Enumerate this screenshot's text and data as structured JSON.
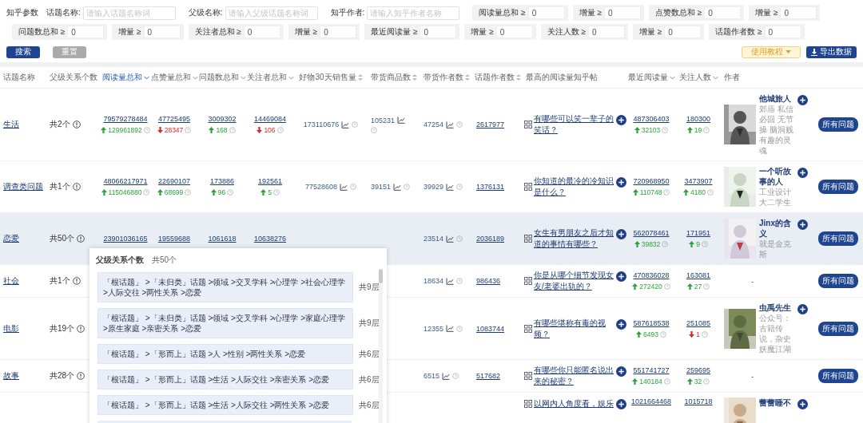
{
  "filters": {
    "section_label": "知乎参数",
    "first_line": [
      {
        "kind": "text",
        "label": "话题名称:",
        "placeholder": "请输入话题名称词"
      },
      {
        "kind": "text",
        "label": "父级名称:",
        "placeholder": "请输入父级话题名称词"
      },
      {
        "kind": "text",
        "label": "知乎作者:",
        "placeholder": "请输入知乎作者名称"
      },
      {
        "kind": "min",
        "label": "阅读量总和 ≥",
        "value": "0"
      },
      {
        "kind": "min",
        "label": "增量 ≥",
        "value": "0"
      },
      {
        "kind": "min",
        "label": "点赞数总和 ≥",
        "value": "0"
      },
      {
        "kind": "min",
        "label": "增量 ≥",
        "value": "0"
      }
    ],
    "second_line": [
      {
        "kind": "min",
        "label": "问题数总和 ≥",
        "value": "0"
      },
      {
        "kind": "min",
        "label": "增量 ≥",
        "value": "0"
      },
      {
        "kind": "min",
        "label": "关注者总和 ≥",
        "value": "0"
      },
      {
        "kind": "min",
        "label": "增量 ≥",
        "value": "0"
      },
      {
        "kind": "min",
        "label": "最近阅读量 ≥",
        "value": "0"
      },
      {
        "kind": "min",
        "label": "增量 ≥",
        "value": "0"
      },
      {
        "kind": "min",
        "label": "关注人数 ≥",
        "value": "0"
      },
      {
        "kind": "min",
        "label": "增量 ≥",
        "value": "0"
      },
      {
        "kind": "min",
        "label": "话题作者数 ≥",
        "value": "0"
      }
    ]
  },
  "actions": {
    "search": "搜索",
    "reset": "重置",
    "tutorial": "使用教程",
    "export": "导出数据"
  },
  "columns": [
    {
      "label": "话题名称",
      "kind": "plain",
      "active": false
    },
    {
      "label": "父级关系个数",
      "kind": "plain",
      "active": false
    },
    {
      "label": "阅读量总和",
      "kind": "desc",
      "active": true
    },
    {
      "label": "点赞量总和",
      "kind": "desc",
      "active": false
    },
    {
      "label": "问题数总和",
      "kind": "desc",
      "active": false
    },
    {
      "label": "关注者总和",
      "kind": "desc",
      "active": false
    },
    {
      "label": "好物30天销售量",
      "kind": "both",
      "active": false
    },
    {
      "label": "带货商品数",
      "kind": "both",
      "active": false
    },
    {
      "label": "带货作者数",
      "kind": "both",
      "active": false
    },
    {
      "label": "话题作者数",
      "kind": "both",
      "active": false
    },
    {
      "label": "最高的阅读量知乎帖",
      "kind": "plain",
      "active": false
    },
    {
      "label": "最近阅读量",
      "kind": "desc",
      "active": false
    },
    {
      "label": "关注人数",
      "kind": "desc",
      "active": false
    },
    {
      "label": "作者",
      "kind": "plain",
      "active": false
    }
  ],
  "rows": [
    {
      "selected": false,
      "topic": "生活",
      "parents": "共2个",
      "reads": {
        "value": "79579278484",
        "delta": "129961892",
        "rising": true
      },
      "likes": {
        "value": "47725495",
        "delta": "28347",
        "rising": false
      },
      "questions": {
        "value": "3009302",
        "delta": "168",
        "rising": true
      },
      "followers": {
        "value": "14469084",
        "delta": "106",
        "rising": false
      },
      "sales": "173110676",
      "products": "105231",
      "goods_authors": "47254",
      "topic_authors": "2617977",
      "post": "有哪些可以笑一辈子的笑话？",
      "recent": {
        "value": "487306403",
        "delta": "32103",
        "rising": true
      },
      "follows": {
        "value": "180300",
        "delta": "19",
        "rising": true
      },
      "author": {
        "kind": "profile",
        "name": "他城旅人",
        "bio": "郊庙 私信必回 无节操 脑洞贱有趣的灵魂"
      },
      "button": "所有问题"
    },
    {
      "selected": false,
      "topic": "调查类问题",
      "parents": "共1个",
      "reads": {
        "value": "48066217971",
        "delta": "115046880",
        "rising": true
      },
      "likes": {
        "value": "22690107",
        "delta": "68699",
        "rising": true
      },
      "questions": {
        "value": "173886",
        "delta": "96",
        "rising": true
      },
      "followers": {
        "value": "192561",
        "delta": "5",
        "rising": true
      },
      "sales": "77528608",
      "products": "39151",
      "goods_authors": "39929",
      "topic_authors": "1376131",
      "post": "你知道的最冷的冷知识是什么？",
      "recent": {
        "value": "720968950",
        "delta": "110748",
        "rising": true
      },
      "follows": {
        "value": "3473907",
        "delta": "4180",
        "rising": true
      },
      "author": {
        "kind": "profile",
        "name": "一个听故事的人",
        "bio": "工业设计大二学生"
      },
      "button": "所有问题"
    },
    {
      "selected": true,
      "topic": "恋爱",
      "parents": "共50个",
      "reads": {
        "value": "23901036165"
      },
      "likes": {
        "value": "19559688"
      },
      "questions": {
        "value": "1061618"
      },
      "followers": {
        "value": "10638276"
      },
      "goods_authors": "23514",
      "topic_authors": "2036189",
      "post": "女生有男朋友之后才知道的事情有哪些？",
      "recent": {
        "value": "562078461",
        "delta": "39832",
        "rising": true
      },
      "follows": {
        "value": "171951",
        "delta": "9",
        "rising": true
      },
      "author": {
        "kind": "profile",
        "name": "Jinx的含义",
        "bio": "就是金克斯"
      },
      "button": "所有问题"
    },
    {
      "selected": false,
      "topic": "社会",
      "parents": "共1个",
      "goods_authors": "18634",
      "topic_authors": "986436",
      "post": "你是从哪个细节发现女友/老婆出轨的？",
      "recent": {
        "value": "470836028",
        "delta": "272420",
        "rising": true
      },
      "follows": {
        "value": "163081",
        "delta": "27",
        "rising": true
      },
      "author": {
        "kind": "empty",
        "text": "-"
      },
      "button": "所有问题"
    },
    {
      "selected": false,
      "topic": "电影",
      "parents": "共19个",
      "goods_authors": "12355",
      "topic_authors": "1083744",
      "post": "有哪些堪称有毒的视频？",
      "recent": {
        "value": "587618538",
        "delta": "6493",
        "rising": true
      },
      "follows": {
        "value": "251085",
        "delta": "1",
        "rising": false
      },
      "author": {
        "kind": "profile",
        "name": "虫禹先生",
        "bio": "公众号：古籍传说，杂史妖魔江湖"
      },
      "button": "所有问题"
    },
    {
      "selected": false,
      "topic": "故事",
      "parents": "共28个",
      "goods_authors": "6515",
      "topic_authors": "517682",
      "post": "有哪些你只能匿名说出来的秘密？",
      "recent": {
        "value": "551741727",
        "delta": "140184",
        "rising": true
      },
      "follows": {
        "value": "259695",
        "delta": "32",
        "rising": true
      },
      "author": {
        "kind": "empty",
        "text": "-"
      },
      "button": "所有问题"
    },
    {
      "selected": false,
      "post": "以网内人角度看，娱乐",
      "recent": {
        "value": "1021664468"
      },
      "follows": {
        "value": "1015718"
      },
      "author": {
        "kind": "profile",
        "name": "蕾蕾睡不"
      }
    }
  ],
  "popup": {
    "title": "父级关系个数",
    "count": "共50个",
    "paths": [
      {
        "text": "「根话题」 >「未归类」话题 >领域 >交叉学科 >心理学 >社会心理学 >人际交往 >两性关系 >恋爱",
        "levels": "共9层"
      },
      {
        "text": "「根话题」 >「未归类」话题 >领域 >交叉学科 >心理学 >家庭心理学 >原生家庭 >亲密关系 >恋爱",
        "levels": "共9层"
      },
      {
        "text": "「根话题」 >「形而上」话题 >人 >性别 >两性关系 >恋爱",
        "levels": "共6层"
      },
      {
        "text": "「根话题」 >「形而上」话题 >生活 >人际交往 >亲密关系 >恋爱",
        "levels": "共6层"
      },
      {
        "text": "「根话题」 >「形而上」话题 >生活 >人际交往 >两性关系 >恋爱",
        "levels": "共6层"
      }
    ]
  }
}
